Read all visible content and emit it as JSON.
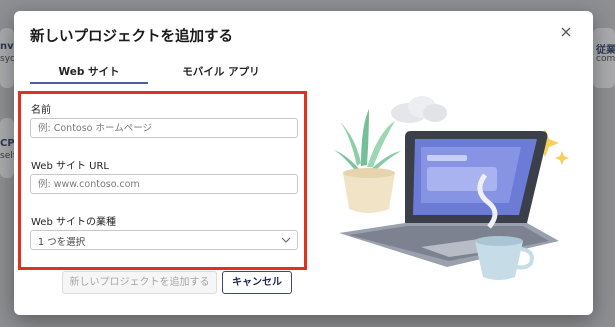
{
  "background": {
    "cards": [
      {
        "title": "nva",
        "sub": "syc"
      },
      {
        "title": "従業",
        "sub": "com"
      },
      {
        "title": "CPA",
        "sub": "self"
      }
    ]
  },
  "dialog": {
    "title": "新しいプロジェクトを追加する",
    "close_icon": "close-icon",
    "tabs": [
      {
        "label": "Web サイト",
        "selected": true
      },
      {
        "label": "モバイル アプリ",
        "selected": false
      }
    ],
    "form": {
      "name": {
        "label": "名前",
        "value": "",
        "placeholder": "例: Contoso ホームページ"
      },
      "url": {
        "label": "Web サイト URL",
        "value": "",
        "placeholder": "例: www.contoso.com"
      },
      "industry": {
        "label": "Web サイトの業種",
        "selected": "1 つを選択"
      }
    },
    "buttons": {
      "add": "新しいプロジェクトを追加する",
      "cancel": "キャンセル"
    },
    "highlight_color": "#e0301e",
    "accent_color": "#4b5fa8"
  }
}
